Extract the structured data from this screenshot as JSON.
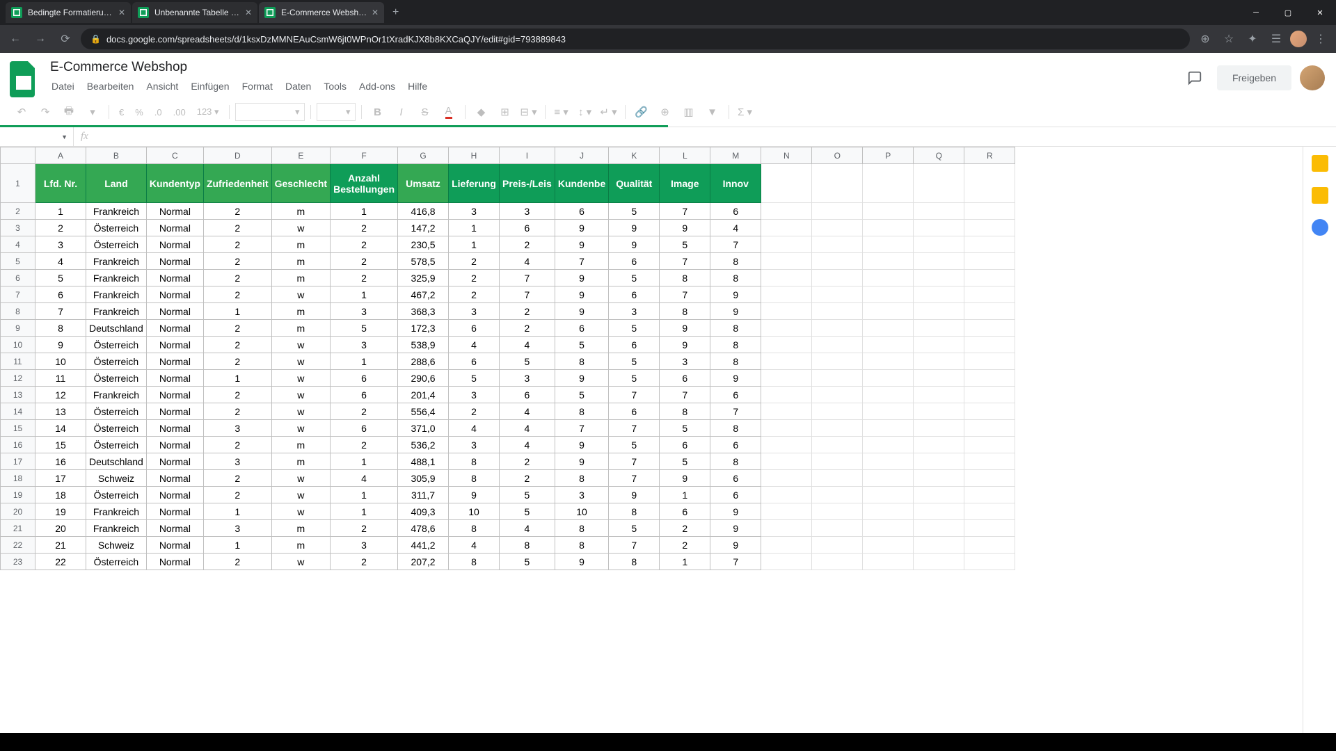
{
  "browser": {
    "tabs": [
      {
        "title": "Bedingte Formatierung - Google",
        "active": false
      },
      {
        "title": "Unbenannte Tabelle - Google Ta",
        "active": false
      },
      {
        "title": "E-Commerce Webshop - Google",
        "active": true
      }
    ],
    "url": "docs.google.com/spreadsheets/d/1ksxDzMMNEAuCsmW6jt0WPnOr1tXradKJX8b8KXCaQJY/edit#gid=793889843"
  },
  "doc": {
    "title": "E-Commerce Webshop",
    "menus": [
      "Datei",
      "Bearbeiten",
      "Ansicht",
      "Einfügen",
      "Format",
      "Daten",
      "Tools",
      "Add-ons",
      "Hilfe"
    ],
    "share_label": "Freigeben"
  },
  "toolbar": {
    "zoom": "123",
    "euro": "€",
    "percent": "%",
    "dec_dec": ".0",
    "dec_inc": ".00"
  },
  "columns": [
    "A",
    "B",
    "C",
    "D",
    "E",
    "F",
    "G",
    "H",
    "I",
    "J",
    "K",
    "L",
    "M",
    "N",
    "O",
    "P",
    "Q",
    "R"
  ],
  "headers": {
    "A": "Lfd. Nr.",
    "B": "Land",
    "C": "Kundentyp",
    "D": "Zufriedenheit",
    "E": "Geschlecht",
    "F": "Anzahl Bestellungen",
    "G": "Umsatz",
    "H": "Lieferung",
    "I": "Preis-/Leis",
    "J": "Kundenbe",
    "K": "Qualität",
    "L": "Image",
    "M": "Innov"
  },
  "light_cols": [
    "A",
    "B",
    "C",
    "D",
    "E",
    "G"
  ],
  "rows": [
    {
      "n": 2,
      "d": [
        "1",
        "Frankreich",
        "Normal",
        "2",
        "m",
        "1",
        "416,8",
        "3",
        "3",
        "6",
        "5",
        "7",
        "6"
      ]
    },
    {
      "n": 3,
      "d": [
        "2",
        "Österreich",
        "Normal",
        "2",
        "w",
        "2",
        "147,2",
        "1",
        "6",
        "9",
        "9",
        "9",
        "4"
      ]
    },
    {
      "n": 4,
      "d": [
        "3",
        "Österreich",
        "Normal",
        "2",
        "m",
        "2",
        "230,5",
        "1",
        "2",
        "9",
        "9",
        "5",
        "7"
      ]
    },
    {
      "n": 5,
      "d": [
        "4",
        "Frankreich",
        "Normal",
        "2",
        "m",
        "2",
        "578,5",
        "2",
        "4",
        "7",
        "6",
        "7",
        "8"
      ]
    },
    {
      "n": 6,
      "d": [
        "5",
        "Frankreich",
        "Normal",
        "2",
        "m",
        "2",
        "325,9",
        "2",
        "7",
        "9",
        "5",
        "8",
        "8"
      ]
    },
    {
      "n": 7,
      "d": [
        "6",
        "Frankreich",
        "Normal",
        "2",
        "w",
        "1",
        "467,2",
        "2",
        "7",
        "9",
        "6",
        "7",
        "9"
      ]
    },
    {
      "n": 8,
      "d": [
        "7",
        "Frankreich",
        "Normal",
        "1",
        "m",
        "3",
        "368,3",
        "3",
        "2",
        "9",
        "3",
        "8",
        "9"
      ]
    },
    {
      "n": 9,
      "d": [
        "8",
        "Deutschland",
        "Normal",
        "2",
        "m",
        "5",
        "172,3",
        "6",
        "2",
        "6",
        "5",
        "9",
        "8"
      ]
    },
    {
      "n": 10,
      "d": [
        "9",
        "Österreich",
        "Normal",
        "2",
        "w",
        "3",
        "538,9",
        "4",
        "4",
        "5",
        "6",
        "9",
        "8"
      ]
    },
    {
      "n": 11,
      "d": [
        "10",
        "Österreich",
        "Normal",
        "2",
        "w",
        "1",
        "288,6",
        "6",
        "5",
        "8",
        "5",
        "3",
        "8"
      ]
    },
    {
      "n": 12,
      "d": [
        "11",
        "Österreich",
        "Normal",
        "1",
        "w",
        "6",
        "290,6",
        "5",
        "3",
        "9",
        "5",
        "6",
        "9"
      ]
    },
    {
      "n": 13,
      "d": [
        "12",
        "Frankreich",
        "Normal",
        "2",
        "w",
        "6",
        "201,4",
        "3",
        "6",
        "5",
        "7",
        "7",
        "6"
      ]
    },
    {
      "n": 14,
      "d": [
        "13",
        "Österreich",
        "Normal",
        "2",
        "w",
        "2",
        "556,4",
        "2",
        "4",
        "8",
        "6",
        "8",
        "7"
      ]
    },
    {
      "n": 15,
      "d": [
        "14",
        "Österreich",
        "Normal",
        "3",
        "w",
        "6",
        "371,0",
        "4",
        "4",
        "7",
        "7",
        "5",
        "8"
      ]
    },
    {
      "n": 16,
      "d": [
        "15",
        "Österreich",
        "Normal",
        "2",
        "m",
        "2",
        "536,2",
        "3",
        "4",
        "9",
        "5",
        "6",
        "6"
      ]
    },
    {
      "n": 17,
      "d": [
        "16",
        "Deutschland",
        "Normal",
        "3",
        "m",
        "1",
        "488,1",
        "8",
        "2",
        "9",
        "7",
        "5",
        "8"
      ]
    },
    {
      "n": 18,
      "d": [
        "17",
        "Schweiz",
        "Normal",
        "2",
        "w",
        "4",
        "305,9",
        "8",
        "2",
        "8",
        "7",
        "9",
        "6"
      ]
    },
    {
      "n": 19,
      "d": [
        "18",
        "Österreich",
        "Normal",
        "2",
        "w",
        "1",
        "311,7",
        "9",
        "5",
        "3",
        "9",
        "1",
        "6"
      ]
    },
    {
      "n": 20,
      "d": [
        "19",
        "Frankreich",
        "Normal",
        "1",
        "w",
        "1",
        "409,3",
        "10",
        "5",
        "10",
        "8",
        "6",
        "9"
      ]
    },
    {
      "n": 21,
      "d": [
        "20",
        "Frankreich",
        "Normal",
        "3",
        "m",
        "2",
        "478,6",
        "8",
        "4",
        "8",
        "5",
        "2",
        "9"
      ]
    },
    {
      "n": 22,
      "d": [
        "21",
        "Schweiz",
        "Normal",
        "1",
        "m",
        "3",
        "441,2",
        "4",
        "8",
        "8",
        "7",
        "2",
        "9"
      ]
    },
    {
      "n": 23,
      "d": [
        "22",
        "Österreich",
        "Normal",
        "2",
        "w",
        "2",
        "207,2",
        "8",
        "5",
        "9",
        "8",
        "1",
        "7"
      ]
    }
  ]
}
